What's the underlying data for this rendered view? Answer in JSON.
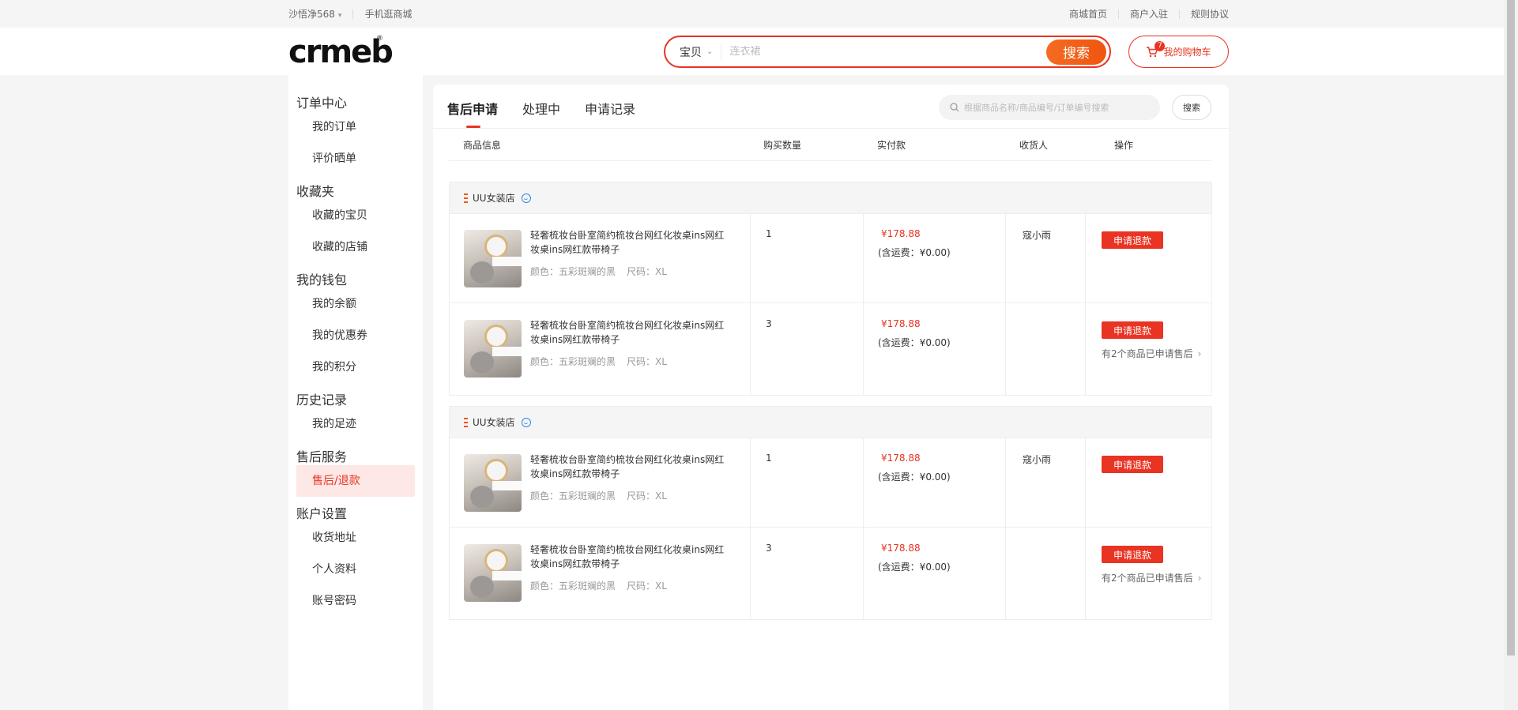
{
  "topbar": {
    "user": "沙悟净568",
    "mobile": "手机逛商城",
    "links": [
      "商城首页",
      "商户入驻",
      "规则协议"
    ]
  },
  "header": {
    "logo": "crmeb",
    "search": {
      "category": "宝贝",
      "placeholder": "连衣裙",
      "button": "搜索"
    },
    "cart": {
      "label": "我的购物车",
      "count": "7"
    }
  },
  "sidebar": {
    "groups": [
      {
        "title": "订单中心",
        "items": [
          "我的订单",
          "评价晒单"
        ]
      },
      {
        "title": "收藏夹",
        "items": [
          "收藏的宝贝",
          "收藏的店铺"
        ]
      },
      {
        "title": "我的钱包",
        "items": [
          "我的余额",
          "我的优惠券",
          "我的积分"
        ]
      },
      {
        "title": "历史记录",
        "items": [
          "我的足迹"
        ]
      },
      {
        "title": "售后服务",
        "items": [
          "售后/退款"
        ]
      },
      {
        "title": "账户设置",
        "items": [
          "收货地址",
          "个人资料",
          "账号密码"
        ]
      }
    ],
    "active": "售后/退款"
  },
  "main": {
    "tabs": [
      "售后申请",
      "处理中",
      "申请记录"
    ],
    "search": {
      "placeholder": "根据商品名称/商品编号/订单编号搜索",
      "button": "搜索"
    },
    "columns": [
      "商品信息",
      "购买数量",
      "实付款",
      "收货人",
      "操作"
    ],
    "orders": [
      {
        "store": "UU女装店",
        "receiver": "寇小雨",
        "items": [
          {
            "name": "轻奢梳妆台卧室简约梳妆台网红化妆桌ins网红妆桌ins网红款带椅子",
            "color": "颜色：五彩斑斓的黑",
            "size": "尺码：XL",
            "qty": "1",
            "price": "¥178.88",
            "ship": "(含运费：¥0.00)",
            "action": "申请退款",
            "note": ""
          },
          {
            "name": "轻奢梳妆台卧室简约梳妆台网红化妆桌ins网红妆桌ins网红款带椅子",
            "color": "颜色：五彩斑斓的黑",
            "size": "尺码：XL",
            "qty": "3",
            "price": "¥178.88",
            "ship": "(含运费：¥0.00)",
            "action": "申请退款",
            "note": "有2个商品已申请售后"
          }
        ]
      },
      {
        "store": "UU女装店",
        "receiver": "寇小雨",
        "items": [
          {
            "name": "轻奢梳妆台卧室简约梳妆台网红化妆桌ins网红妆桌ins网红款带椅子",
            "color": "颜色：五彩斑斓的黑",
            "size": "尺码：XL",
            "qty": "1",
            "price": "¥178.88",
            "ship": "(含运费：¥0.00)",
            "action": "申请退款",
            "note": ""
          },
          {
            "name": "轻奢梳妆台卧室简约梳妆台网红化妆桌ins网红妆桌ins网红款带椅子",
            "color": "颜色：五彩斑斓的黑",
            "size": "尺码：XL",
            "qty": "3",
            "price": "¥178.88",
            "ship": "(含运费：¥0.00)",
            "action": "申请退款",
            "note": "有2个商品已申请售后"
          }
        ]
      }
    ]
  },
  "colors": {
    "accent": "#e93323",
    "orange": "#f0550e",
    "chat": "#2b8ae8"
  }
}
